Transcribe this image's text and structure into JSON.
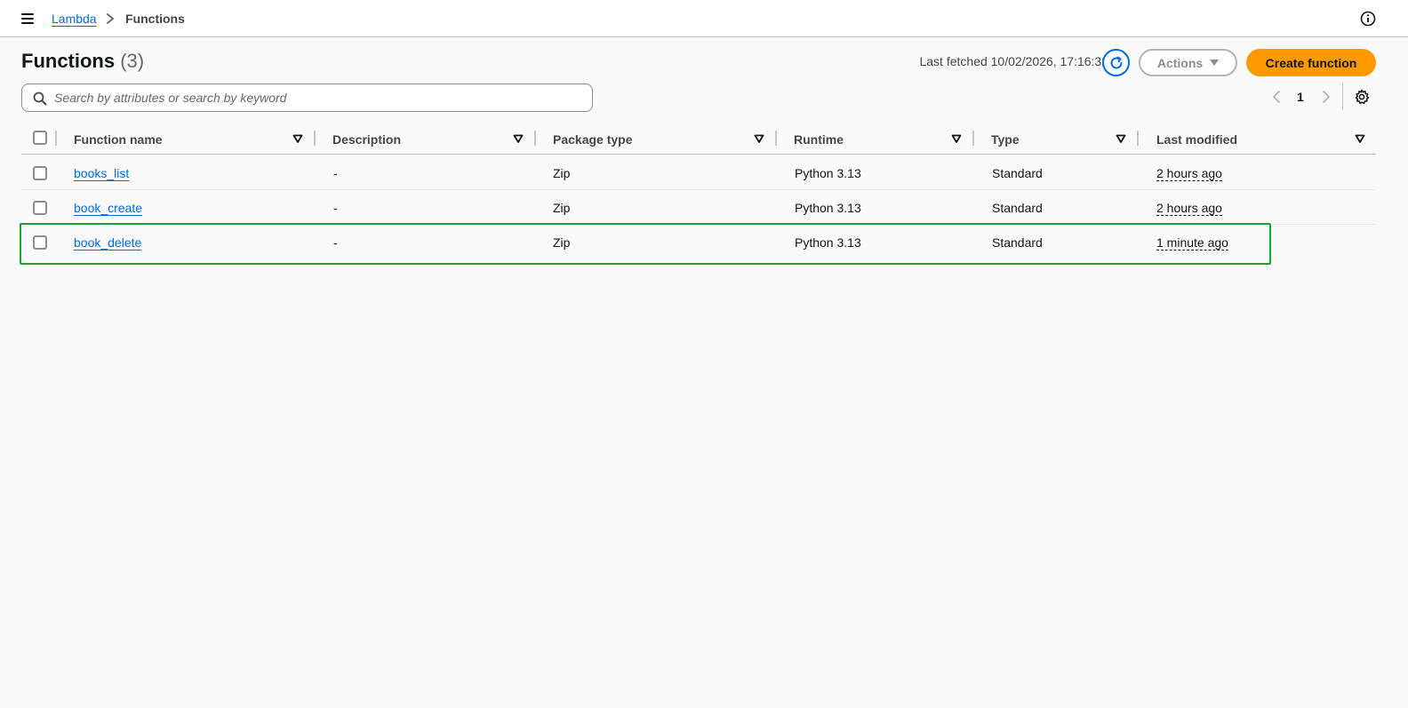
{
  "breadcrumb": {
    "root": "Lambda",
    "current": "Functions"
  },
  "header": {
    "title": "Functions",
    "count": "(3)",
    "last_fetched": "Last fetched 10/02/2026, 17:16:32",
    "actions_label": "Actions",
    "create_label": "Create function"
  },
  "search": {
    "placeholder": "Search by attributes or search by keyword",
    "value": ""
  },
  "pagination": {
    "current_page": "1"
  },
  "table": {
    "columns": [
      "Function name",
      "Description",
      "Package type",
      "Runtime",
      "Type",
      "Last modified"
    ],
    "rows": [
      {
        "name": "books_list",
        "description": "-",
        "package_type": "Zip",
        "runtime": "Python 3.13",
        "type": "Standard",
        "last_modified": "2 hours ago"
      },
      {
        "name": "book_create",
        "description": "-",
        "package_type": "Zip",
        "runtime": "Python 3.13",
        "type": "Standard",
        "last_modified": "2 hours ago"
      },
      {
        "name": "book_delete",
        "description": "-",
        "package_type": "Zip",
        "runtime": "Python 3.13",
        "type": "Standard",
        "last_modified": "1 minute ago"
      }
    ]
  },
  "icons": {
    "menu": "menu-icon",
    "breadcrumb_separator": "chevron-right-icon",
    "info": "info-icon",
    "refresh": "refresh-icon",
    "dropdown": "caret-down-icon",
    "search": "search-icon",
    "prev": "chevron-left-icon",
    "next": "chevron-right-icon",
    "settings": "gear-icon",
    "sort": "sort-icon"
  },
  "colors": {
    "primary_link": "#006ce0",
    "create_button": "#ff9900",
    "highlight_border": "#1aa335",
    "text": "#0f141a"
  },
  "highlighted_row": "book_delete"
}
